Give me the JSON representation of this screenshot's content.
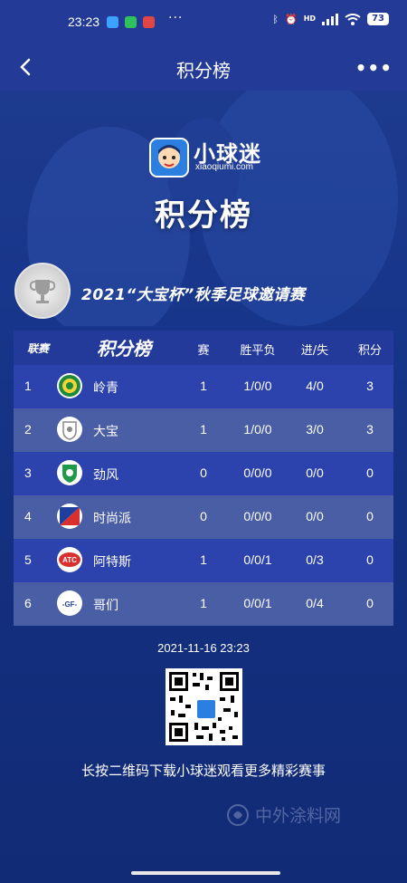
{
  "status_bar": {
    "time": "23:23",
    "more": "···",
    "network": "HD",
    "battery": "73"
  },
  "navbar": {
    "title": "积分榜"
  },
  "brand": {
    "name": "小球迷",
    "pinyin": "xiaoqiumi.com"
  },
  "hero_title": "积分榜",
  "event": {
    "name": "2021“大宝杯”秋季足球邀请赛"
  },
  "table": {
    "league_label": "联赛",
    "title": "积分榜",
    "columns": [
      "赛",
      "胜平负",
      "进/失",
      "积分"
    ],
    "rows": [
      {
        "rank": "1",
        "team": "岭青",
        "played": "1",
        "wdl": "1/0/0",
        "goals": "4/0",
        "points": "3",
        "logo": "team-lingqing"
      },
      {
        "rank": "2",
        "team": "大宝",
        "played": "1",
        "wdl": "1/0/0",
        "goals": "3/0",
        "points": "3",
        "logo": "team-dabao"
      },
      {
        "rank": "3",
        "team": "劲风",
        "played": "0",
        "wdl": "0/0/0",
        "goals": "0/0",
        "points": "0",
        "logo": "team-jinfeng"
      },
      {
        "rank": "4",
        "team": "时尚派",
        "played": "0",
        "wdl": "0/0/0",
        "goals": "0/0",
        "points": "0",
        "logo": "team-shishangpai"
      },
      {
        "rank": "5",
        "team": "阿特斯",
        "played": "1",
        "wdl": "0/0/1",
        "goals": "0/3",
        "points": "0",
        "logo": "team-ATC"
      },
      {
        "rank": "6",
        "team": "哥们",
        "played": "1",
        "wdl": "0/0/1",
        "goals": "0/4",
        "points": "0",
        "logo": "team-GF"
      }
    ]
  },
  "logo_text": {
    "atc": "ATC",
    "gf": "-GF-"
  },
  "timestamp": "2021-11-16 23:23",
  "qr_caption": "长按二维码下载小球迷观看更多精彩赛事",
  "watermark": "中外涂料网",
  "colors": {
    "header_bg": "#233b96",
    "poster_bg": "#17358a",
    "row_odd": "#2c43ad",
    "row_even": "#4a5ea6"
  }
}
